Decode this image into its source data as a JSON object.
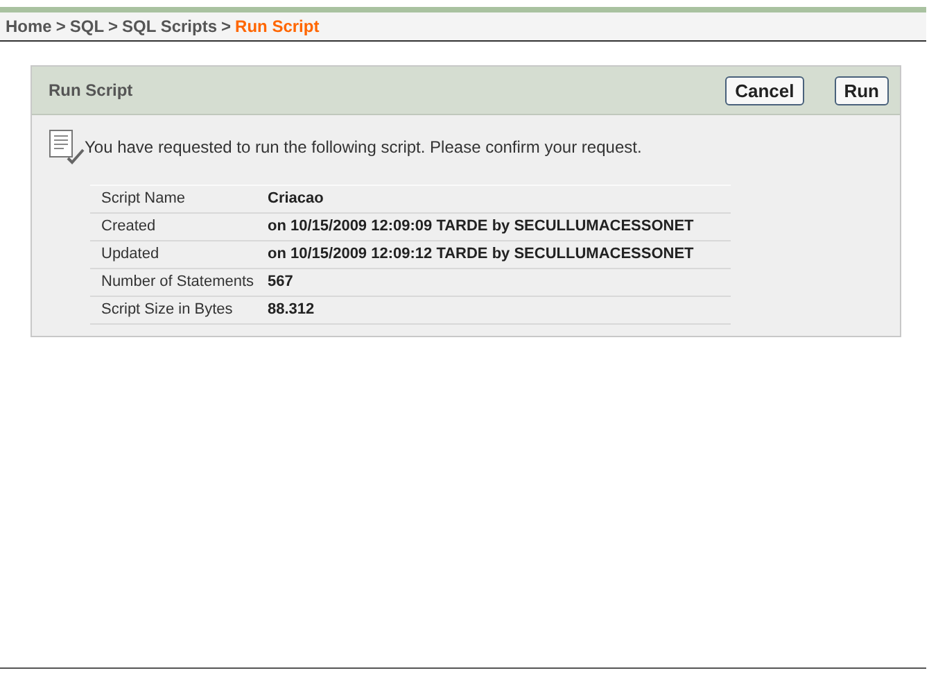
{
  "breadcrumb": [
    {
      "label": "Home",
      "selected": false
    },
    {
      "label": "SQL",
      "selected": false
    },
    {
      "label": "SQL Scripts",
      "selected": false
    },
    {
      "label": "Run Script",
      "selected": true
    }
  ],
  "breadcrumb_separator": ">",
  "panel": {
    "title": "Run Script",
    "buttons": [
      "Cancel",
      "Run"
    ],
    "message": "You have requested to run the following script. Please confirm your request.",
    "rows": [
      {
        "label": "Script Name",
        "value": "Criacao"
      },
      {
        "label": "Created",
        "value": "on 10/15/2009 12:09:09 TARDE by SECULLUMACESSONET"
      },
      {
        "label": "Updated",
        "value": "on 10/15/2009 12:09:12 TARDE by SECULLUMACESSONET"
      },
      {
        "label": "Number of Statements",
        "value": "567"
      },
      {
        "label": "Script Size in Bytes",
        "value": "88.312"
      }
    ]
  }
}
